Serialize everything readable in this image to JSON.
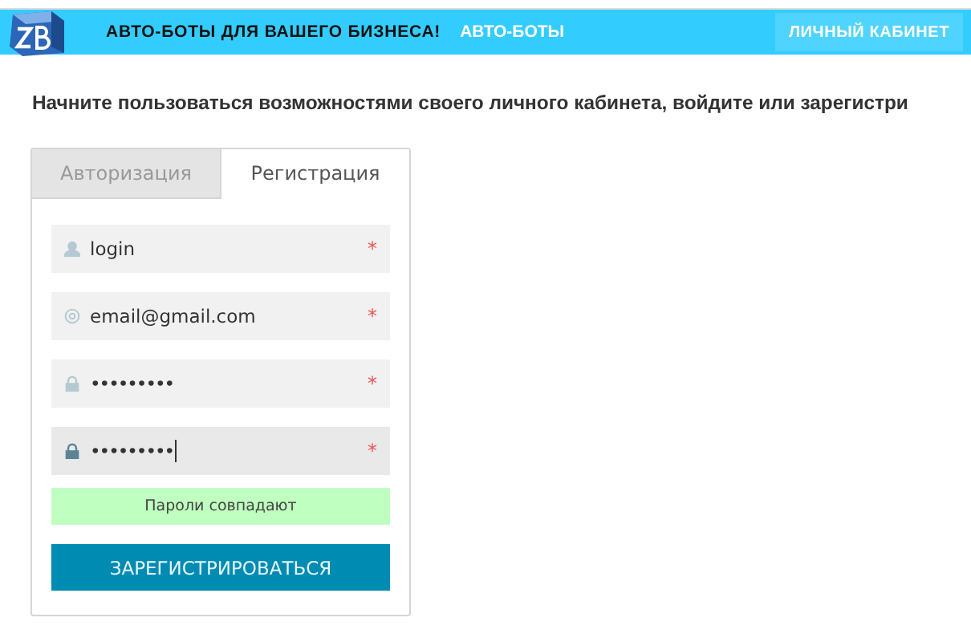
{
  "header": {
    "tagline": "АВТО-БОТЫ ДЛЯ ВАШЕГО БИЗНЕСА!",
    "link": "АВТО-БОТЫ",
    "account_button": "ЛИЧНЫЙ КАБИНЕТ"
  },
  "intro": "Начните пользоваться возможностями своего личного кабинета, войдите или зарегистри",
  "tabs": [
    {
      "label": "Авторизация",
      "selected": false
    },
    {
      "label": "Регистрация",
      "selected": true
    }
  ],
  "fields": [
    {
      "kind": "login",
      "value": "login",
      "required_mark": "*",
      "focused": false
    },
    {
      "kind": "email",
      "value": "email@gmail.com",
      "required_mark": "*",
      "focused": false
    },
    {
      "kind": "password",
      "value": "•••••••••",
      "required_mark": "*",
      "focused": false
    },
    {
      "kind": "password",
      "value": "•••••••••",
      "required_mark": "*",
      "focused": true
    }
  ],
  "match_message": "Пароли совпадают",
  "submit_button": "ЗАРЕГИСТРИРОВАТЬСЯ"
}
